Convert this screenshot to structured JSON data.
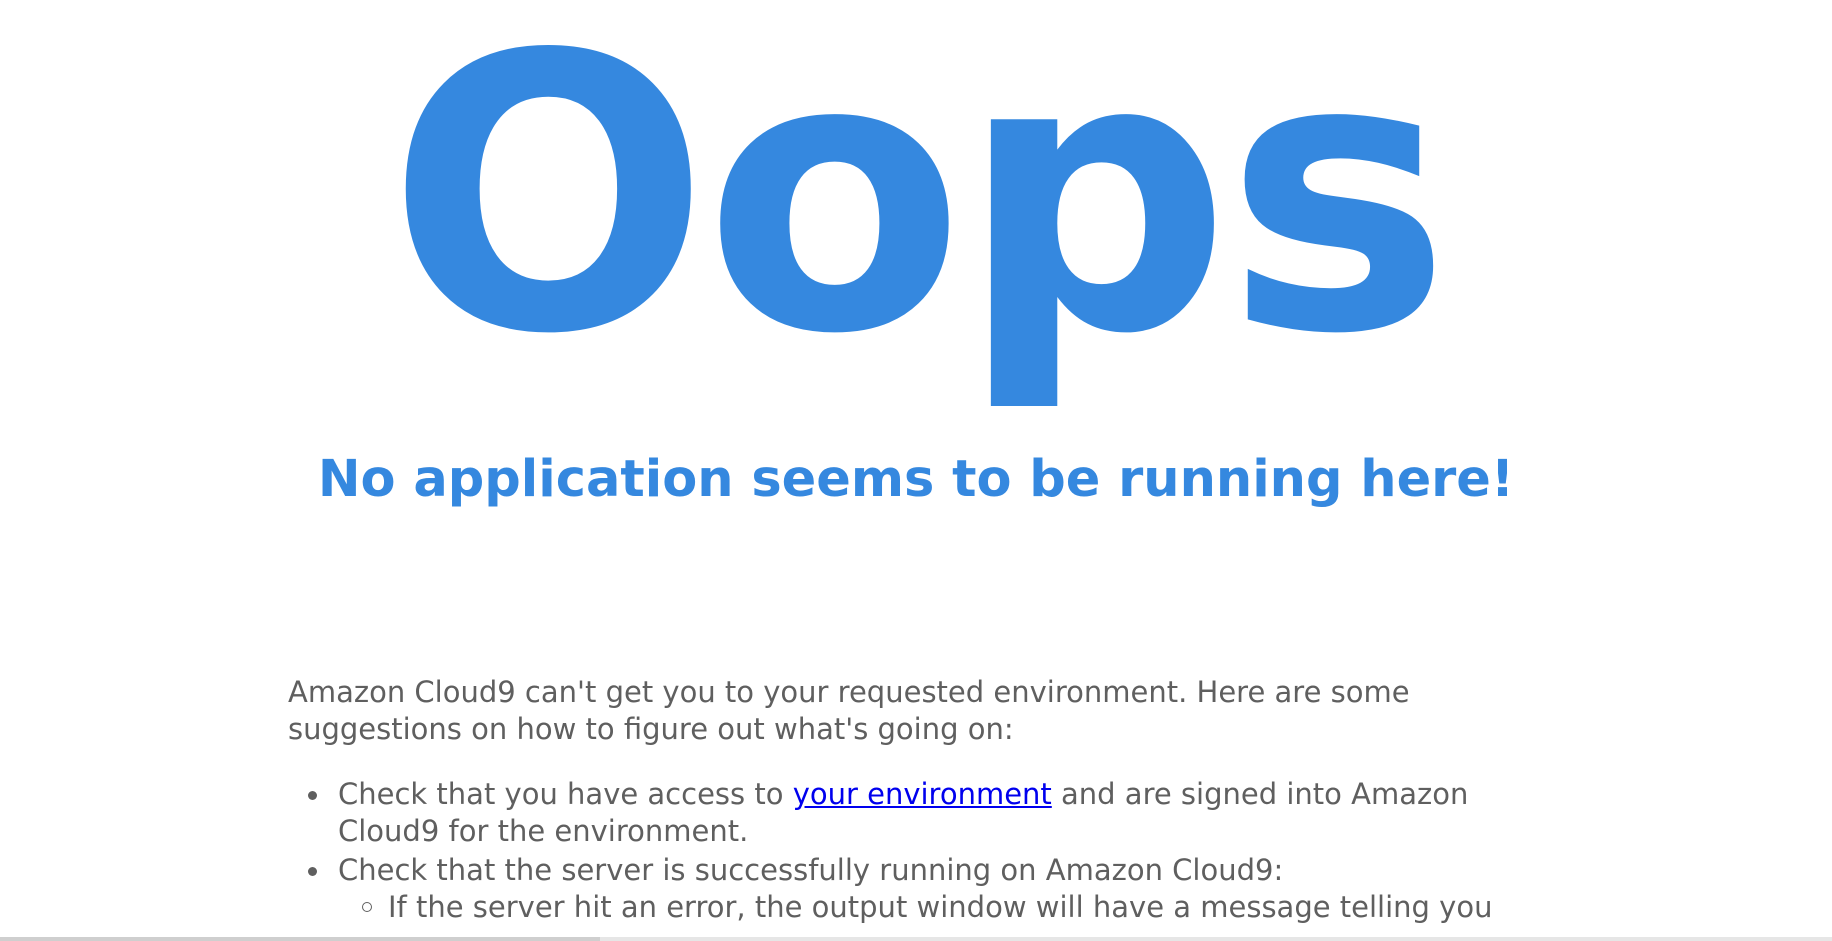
{
  "heading": "Oops",
  "subheading": "No application seems to be running here!",
  "intro": "Amazon Cloud9 can't get you to your requested environment. Here are some suggestions on how to figure out what's going on:",
  "suggestions": [
    {
      "before_link": "Check that you have access to ",
      "link_text": "your environment",
      "after_link": " and are signed into Amazon Cloud9 for the environment."
    },
    {
      "text": "Check that the server is successfully running on Amazon Cloud9:",
      "sub_items": [
        "If the server hit an error, the output window will have a message telling you"
      ]
    }
  ],
  "colors": {
    "accent": "#3588df",
    "body_text": "#5f5f5f",
    "link": "#0000ee",
    "background": "#ffffff"
  }
}
